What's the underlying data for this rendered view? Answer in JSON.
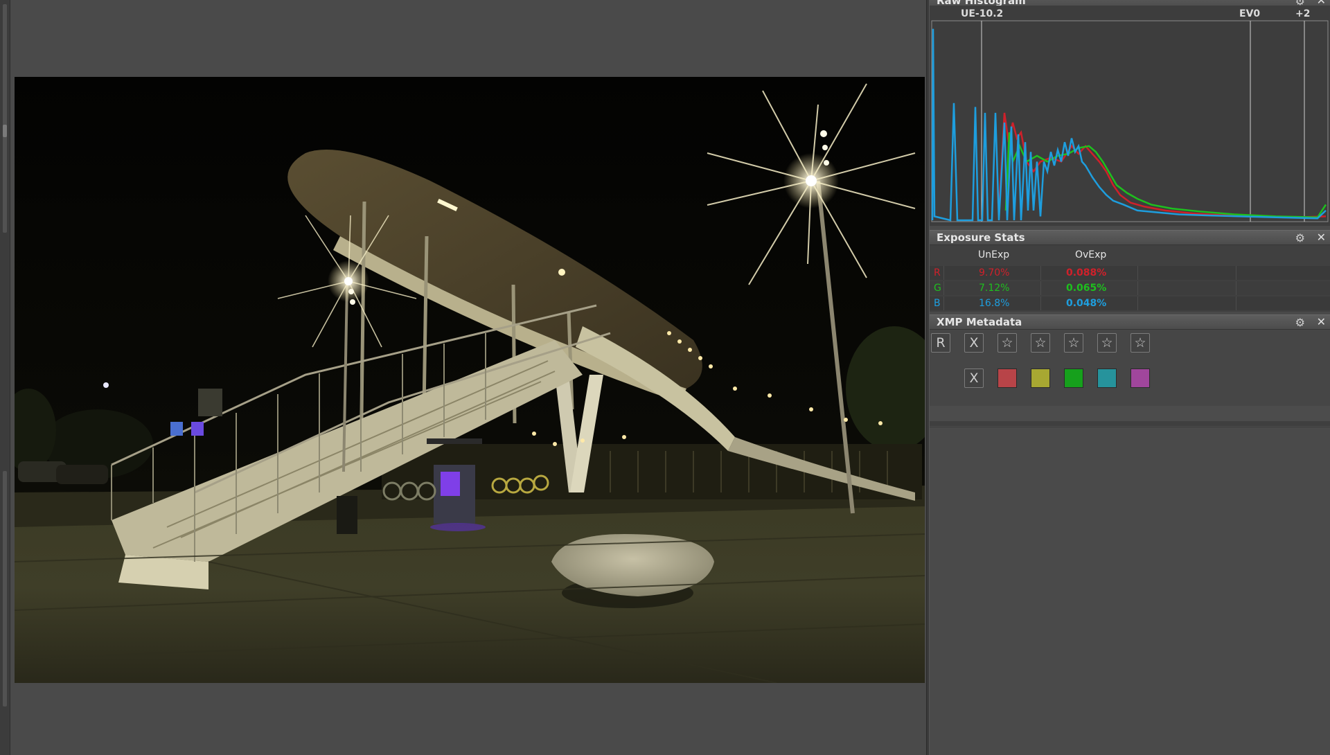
{
  "panels": {
    "histogram": {
      "title": "Raw Histogram",
      "label_unexp": "UE-10.2",
      "label_ev0": "EV0",
      "label_plus2": "+2"
    },
    "exposure_stats": {
      "title": "Exposure Stats",
      "col_unexp": "UnExp",
      "col_ovexp": "OvExp",
      "rows": [
        {
          "channel": "R",
          "unexp": "9.70%",
          "ovexp": "0.088%"
        },
        {
          "channel": "G",
          "unexp": "7.12%",
          "ovexp": "0.065%"
        },
        {
          "channel": "B",
          "unexp": "16.8%",
          "ovexp": "0.048%"
        }
      ]
    },
    "xmp": {
      "title": "XMP Metadata",
      "reject_label": "R",
      "clear_rating_label": "X",
      "clear_color_label": "X",
      "star_glyph": "☆",
      "stars": 5
    }
  },
  "icons": {
    "gear": "gear-icon",
    "close": "close-icon"
  },
  "glyphs": {
    "gear": "⚙",
    "close": "✕"
  },
  "colors": {
    "red": "#d0202a",
    "green": "#1ec01e",
    "blue": "#1e9ede",
    "label_red": "#b84448",
    "label_yellow": "#a8a832",
    "label_green": "#16a01c",
    "label_teal": "#26939c",
    "label_purple": "#a0469c"
  }
}
